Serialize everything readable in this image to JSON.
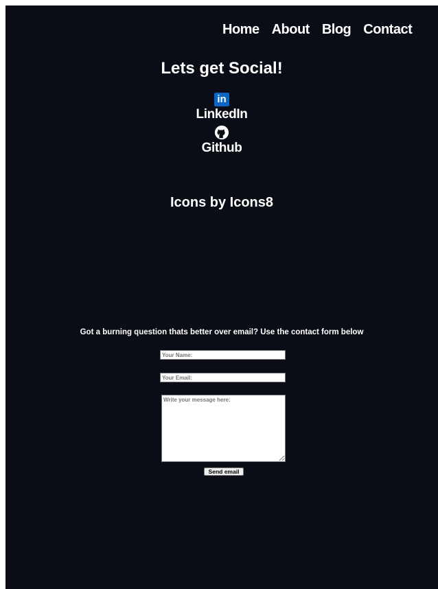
{
  "nav": {
    "items": [
      "Home",
      "About",
      "Blog",
      "Contact"
    ]
  },
  "social": {
    "heading": "Lets get Social!",
    "linkedin": {
      "logo_text": "in",
      "label": "LinkedIn",
      "icon": "linkedin-icon",
      "color": "#0a66c2"
    },
    "github": {
      "label": "Github",
      "icon": "github-icon"
    }
  },
  "credit": "Icons by Icons8",
  "contact": {
    "intro": "Got a burning question thats better over email? Use the contact form below",
    "name_placeholder": "Your Name:",
    "email_placeholder": "Your Email:",
    "message_placeholder": "Write your message here:",
    "send_label": "Send email"
  },
  "colors": {
    "background": "#0a0d15",
    "text": "#ffffff"
  }
}
